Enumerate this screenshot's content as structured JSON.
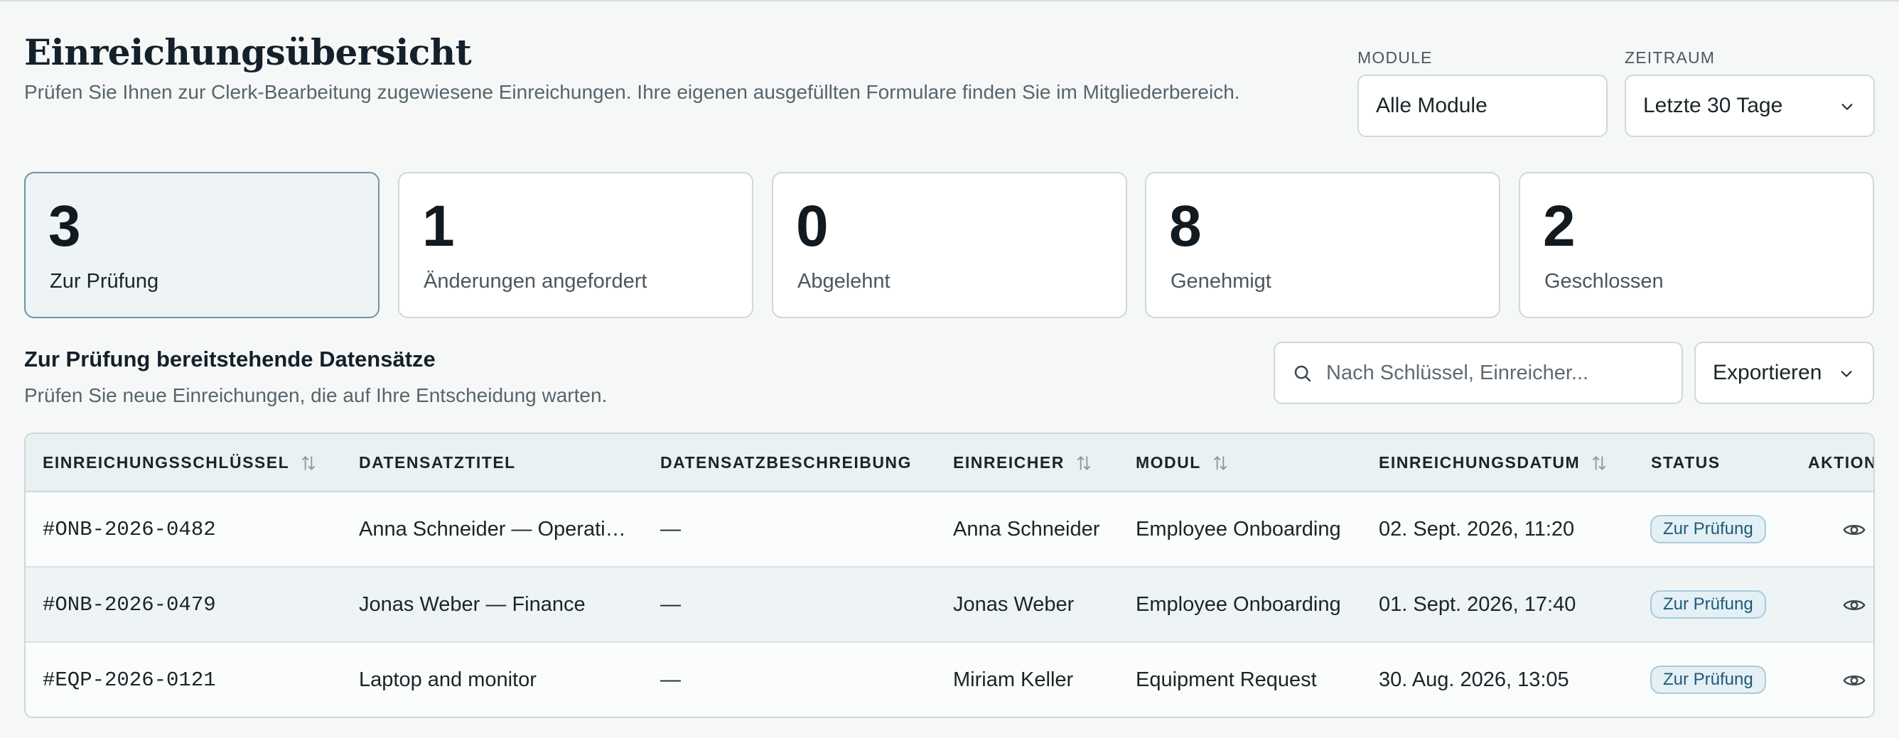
{
  "header": {
    "title": "Einreichungsübersicht",
    "subtitle": "Prüfen Sie Ihnen zur Clerk-Bearbeitung zugewiesene Einreichungen. Ihre eigenen ausgefüllten Formulare finden Sie im Mitgliederbereich."
  },
  "filters": {
    "module_label": "MODULE",
    "module_value": "Alle Module",
    "period_label": "ZEITRAUM",
    "period_value": "Letzte 30 Tage"
  },
  "stats": [
    {
      "count": "3",
      "label": "Zur Prüfung",
      "active": true
    },
    {
      "count": "1",
      "label": "Änderungen angefordert",
      "active": false
    },
    {
      "count": "0",
      "label": "Abgelehnt",
      "active": false
    },
    {
      "count": "8",
      "label": "Genehmigt",
      "active": false
    },
    {
      "count": "2",
      "label": "Geschlossen",
      "active": false
    }
  ],
  "section": {
    "title": "Zur Prüfung bereitstehende Datensätze",
    "subtitle": "Prüfen Sie neue Einreichungen, die auf Ihre Entscheidung warten."
  },
  "search": {
    "placeholder": "Nach Schlüssel, Einreicher..."
  },
  "export_label": "Exportieren",
  "table": {
    "columns": [
      {
        "label": "EINREICHUNGSSCHLÜSSEL",
        "sortable": true
      },
      {
        "label": "DATENSATZTITEL",
        "sortable": false
      },
      {
        "label": "DATENSATZBESCHREIBUNG",
        "sortable": false
      },
      {
        "label": "EINREICHER",
        "sortable": true
      },
      {
        "label": "MODUL",
        "sortable": true
      },
      {
        "label": "EINREICHUNGSDATUM",
        "sortable": true
      },
      {
        "label": "STATUS",
        "sortable": false
      },
      {
        "label": "AKTION",
        "sortable": false
      }
    ],
    "rows": [
      {
        "key": "#ONB-2026-0482",
        "title": "Anna Schneider — Operations",
        "description": "—",
        "submitter": "Anna Schneider",
        "module": "Employee Onboarding",
        "date": "02. Sept. 2026, 11:20",
        "status": "Zur Prüfung"
      },
      {
        "key": "#ONB-2026-0479",
        "title": "Jonas Weber — Finance",
        "description": "—",
        "submitter": "Jonas Weber",
        "module": "Employee Onboarding",
        "date": "01. Sept. 2026, 17:40",
        "status": "Zur Prüfung"
      },
      {
        "key": "#EQP-2026-0121",
        "title": "Laptop and monitor",
        "description": "—",
        "submitter": "Miriam Keller",
        "module": "Equipment Request",
        "date": "30. Aug. 2026, 13:05",
        "status": "Zur Prüfung"
      }
    ]
  },
  "colors": {
    "accent": "#6e94a4",
    "badge_bg": "#e3f0f6",
    "badge_text": "#1f5a74"
  }
}
